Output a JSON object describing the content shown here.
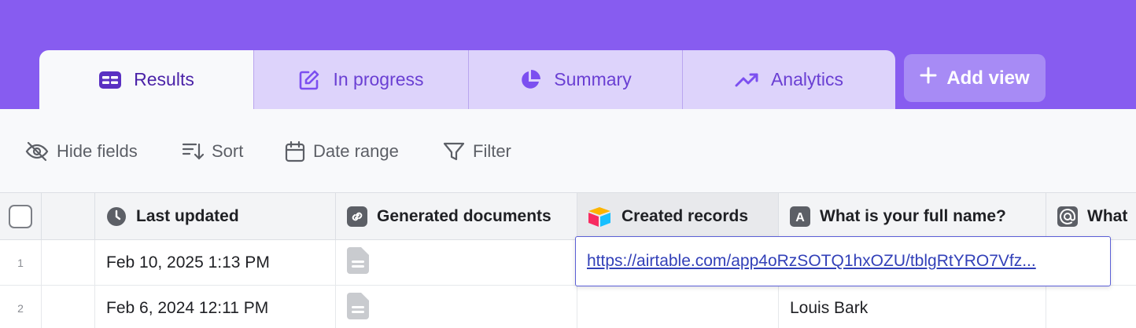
{
  "tabs": [
    {
      "label": "Results",
      "icon": "table-icon",
      "active": true
    },
    {
      "label": "In progress",
      "icon": "edit-icon",
      "active": false
    },
    {
      "label": "Summary",
      "icon": "pie-chart-icon",
      "active": false
    },
    {
      "label": "Analytics",
      "icon": "trending-up-icon",
      "active": false
    }
  ],
  "add_view": {
    "label": "Add view",
    "icon": "plus-icon"
  },
  "toolbar": {
    "hide_fields": "Hide fields",
    "sort": "Sort",
    "date_range": "Date range",
    "filter": "Filter"
  },
  "columns": [
    {
      "label": "Last updated",
      "icon": "clock-icon"
    },
    {
      "label": "Generated documents",
      "icon": "link-icon"
    },
    {
      "label": "Created records",
      "icon": "airtable-logo-icon"
    },
    {
      "label": "What is your full name?",
      "icon": "text-field-icon"
    },
    {
      "label": "What",
      "icon": "at-sign-icon"
    }
  ],
  "rows": [
    {
      "num": "1",
      "last_updated": "Feb 10, 2025 1:13 PM",
      "created_records": "",
      "full_name": ""
    },
    {
      "num": "2",
      "last_updated": "Feb 6, 2024 12:11 PM",
      "created_records": "",
      "full_name": "Louis Bark"
    }
  ],
  "popup": {
    "url": "https://airtable.com/app4oRzSOTQ1hxOZU/tblgRtYRO7Vfz..."
  },
  "colors": {
    "header_purple": "#875cf0",
    "active_text": "#4b23a8",
    "link": "#3240b8"
  }
}
